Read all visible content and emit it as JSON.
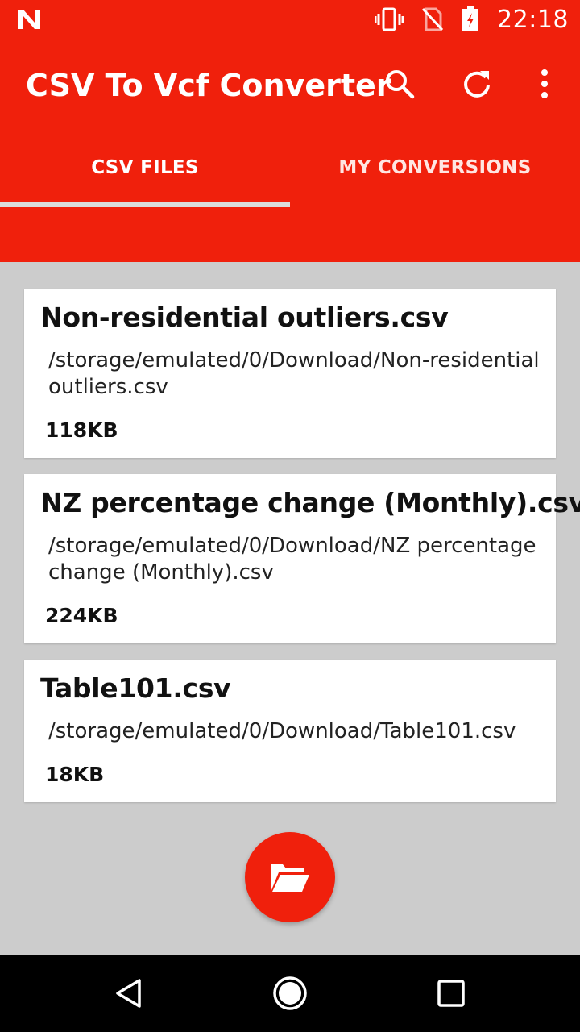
{
  "status_bar": {
    "time": "22:18",
    "icons": [
      "notification-n-icon",
      "vibrate-icon",
      "no-sim-icon",
      "battery-charging-icon"
    ]
  },
  "app_bar": {
    "title": "CSV To Vcf Converter",
    "actions": [
      "search-icon",
      "refresh-icon",
      "more-vert-icon"
    ]
  },
  "tabs": [
    {
      "label": "CSV FILES",
      "active": true
    },
    {
      "label": "MY CONVERSIONS",
      "active": false
    }
  ],
  "files": [
    {
      "name": "Non-residential outliers.csv",
      "path": "/storage/emulated/0/Download/Non-residential outliers.csv",
      "size": "118KB"
    },
    {
      "name": "NZ percentage change (Monthly).csv",
      "path": "/storage/emulated/0/Download/NZ percentage change (Monthly).csv",
      "size": "224KB"
    },
    {
      "name": "Table101.csv",
      "path": "/storage/emulated/0/Download/Table101.csv",
      "size": "18KB"
    }
  ],
  "fab": {
    "icon": "folder-open-icon"
  },
  "colors": {
    "primary": "#f0200c",
    "background": "#cccccc",
    "card": "#ffffff",
    "tab_indicator": "#dcdcdc"
  }
}
